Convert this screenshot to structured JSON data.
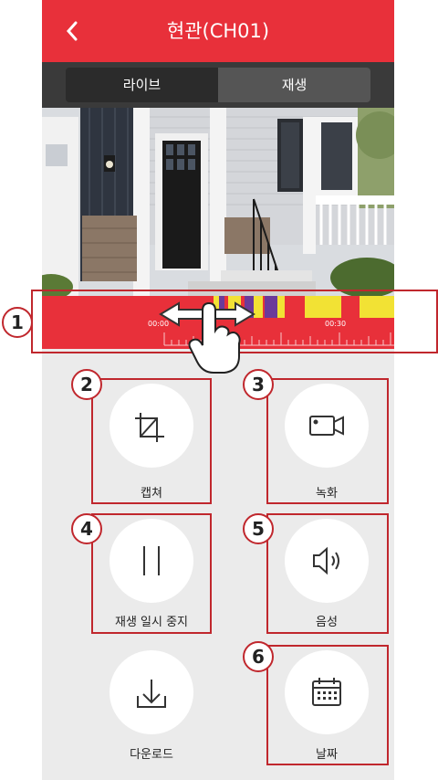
{
  "header": {
    "title": "현관(CH01)",
    "back_icon": "chevron-left-icon"
  },
  "tabs": [
    {
      "label": "라이브"
    },
    {
      "label": "재생"
    }
  ],
  "timeline": {
    "start_label": "00:00",
    "mid_label": "00:30"
  },
  "buttons": {
    "capture": {
      "label": "캡쳐",
      "icon": "crop-icon"
    },
    "record": {
      "label": "녹화",
      "icon": "video-camera-icon"
    },
    "pause": {
      "label": "재생 일시 중지",
      "icon": "pause-icon"
    },
    "audio": {
      "label": "음성",
      "icon": "speaker-icon"
    },
    "download": {
      "label": "다운로드",
      "icon": "download-icon"
    },
    "date": {
      "label": "날짜",
      "icon": "calendar-icon"
    }
  },
  "annotations": [
    "1",
    "2",
    "3",
    "4",
    "5",
    "6"
  ],
  "colors": {
    "accent": "#e8303a",
    "annotation": "#c0272d",
    "event_yellow": "#f2e234",
    "event_purple": "#6b3a9a"
  }
}
